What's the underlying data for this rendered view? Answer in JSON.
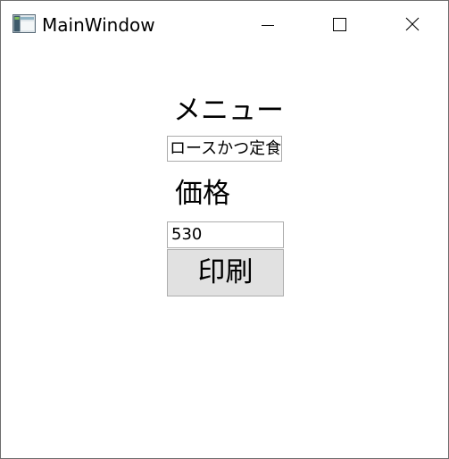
{
  "window": {
    "title": "MainWindow",
    "icon": "window-app-icon",
    "controls": {
      "minimize_icon": "minimize-icon",
      "maximize_icon": "maximize-icon",
      "close_icon": "close-icon"
    }
  },
  "form": {
    "menu_label": "メニュー",
    "menu_value": "ロースかつ定食",
    "price_label": "価格",
    "price_value": "530",
    "print_button_label": "印刷"
  },
  "colors": {
    "button_background": "#e1e1e1",
    "input_border": "#ababab",
    "window_border": "#6d6d6d"
  }
}
